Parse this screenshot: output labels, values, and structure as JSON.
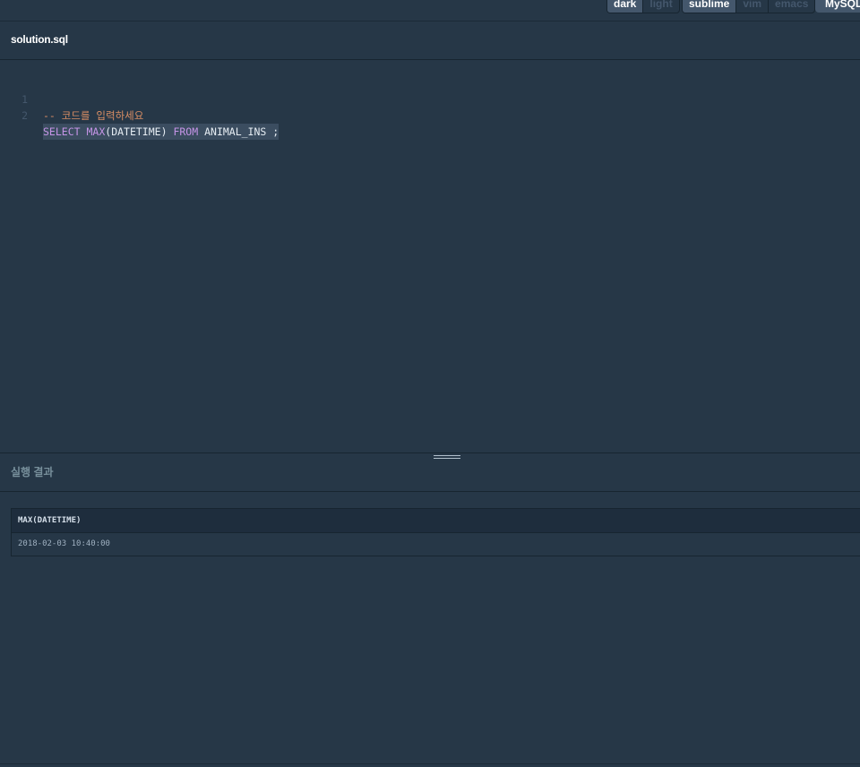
{
  "toolbar": {
    "theme_options": [
      "dark",
      "light"
    ],
    "theme_selected": "dark",
    "keymap_options": [
      "sublime",
      "vim",
      "emacs"
    ],
    "keymap_selected": "sublime",
    "language": "MySQL"
  },
  "file": {
    "name": "solution.sql"
  },
  "editor": {
    "lines": [
      {
        "number": "1",
        "text": "-- 코드를 입력하세요"
      },
      {
        "number": "2",
        "kw1": "SELECT",
        "fn": "MAX",
        "args": "(DATETIME)",
        "kw2": "FROM",
        "rest": "ANIMAL_INS ;"
      }
    ]
  },
  "result": {
    "title": "실행 결과",
    "columns": [
      "MAX(DATETIME)"
    ],
    "rows": [
      [
        "2018-02-03 10:40:00"
      ]
    ]
  },
  "colors": {
    "background": "#263747",
    "keyword": "#c594e6",
    "comment": "#d98e64",
    "active_button": "#44576c"
  }
}
